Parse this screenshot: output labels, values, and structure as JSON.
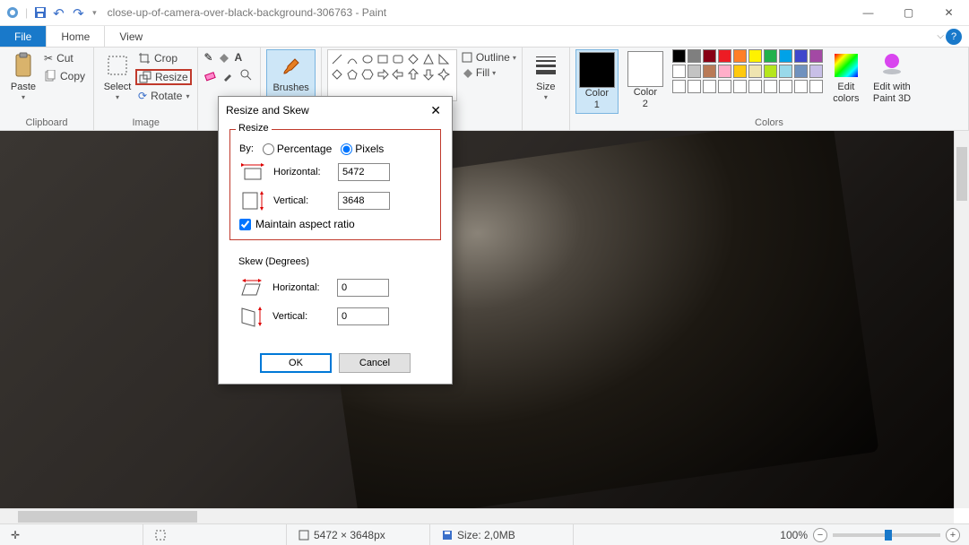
{
  "title": "close-up-of-camera-over-black-background-306763 - Paint",
  "menus": {
    "file": "File",
    "home": "Home",
    "view": "View"
  },
  "ribbon": {
    "clipboard": {
      "label": "Clipboard",
      "paste": "Paste",
      "cut": "Cut",
      "copy": "Copy"
    },
    "image": {
      "label": "Image",
      "select": "Select",
      "crop": "Crop",
      "resize": "Resize",
      "rotate": "Rotate"
    },
    "tools": {
      "label": "Tools"
    },
    "brushes": {
      "label": "Brushes"
    },
    "shapes": {
      "label": "Shapes",
      "outline": "Outline",
      "fill": "Fill"
    },
    "size_group": "Size",
    "colors": {
      "label": "Colors",
      "c1": "Color\n1",
      "c2": "Color\n2",
      "edit": "Edit\ncolors",
      "p3d": "Edit with\nPaint 3D"
    }
  },
  "dialog": {
    "title": "Resize and Skew",
    "resize_legend": "Resize",
    "by": "By:",
    "percentage": "Percentage",
    "pixels": "Pixels",
    "horizontal": "Horizontal:",
    "vertical": "Vertical:",
    "h_value": "5472",
    "v_value": "3648",
    "maintain": "Maintain aspect ratio",
    "skew_legend": "Skew (Degrees)",
    "skew_h": "0",
    "skew_v": "0",
    "ok": "OK",
    "cancel": "Cancel"
  },
  "status": {
    "dims": "5472 × 3648px",
    "size": "Size: 2,0MB",
    "zoom": "100%"
  },
  "palette": {
    "row1": [
      "#000000",
      "#7f7f7f",
      "#880015",
      "#ed1c24",
      "#ff7f27",
      "#fff200",
      "#22b14c",
      "#00a2e8",
      "#3f48cc",
      "#a349a4"
    ],
    "row2": [
      "#ffffff",
      "#c3c3c3",
      "#b97a57",
      "#ffaec9",
      "#ffc90e",
      "#efe4b0",
      "#b5e61d",
      "#99d9ea",
      "#7092be",
      "#c8bfe7"
    ],
    "row3": [
      "#ffffff",
      "#ffffff",
      "#ffffff",
      "#ffffff",
      "#ffffff",
      "#ffffff",
      "#ffffff",
      "#ffffff",
      "#ffffff",
      "#ffffff"
    ]
  }
}
